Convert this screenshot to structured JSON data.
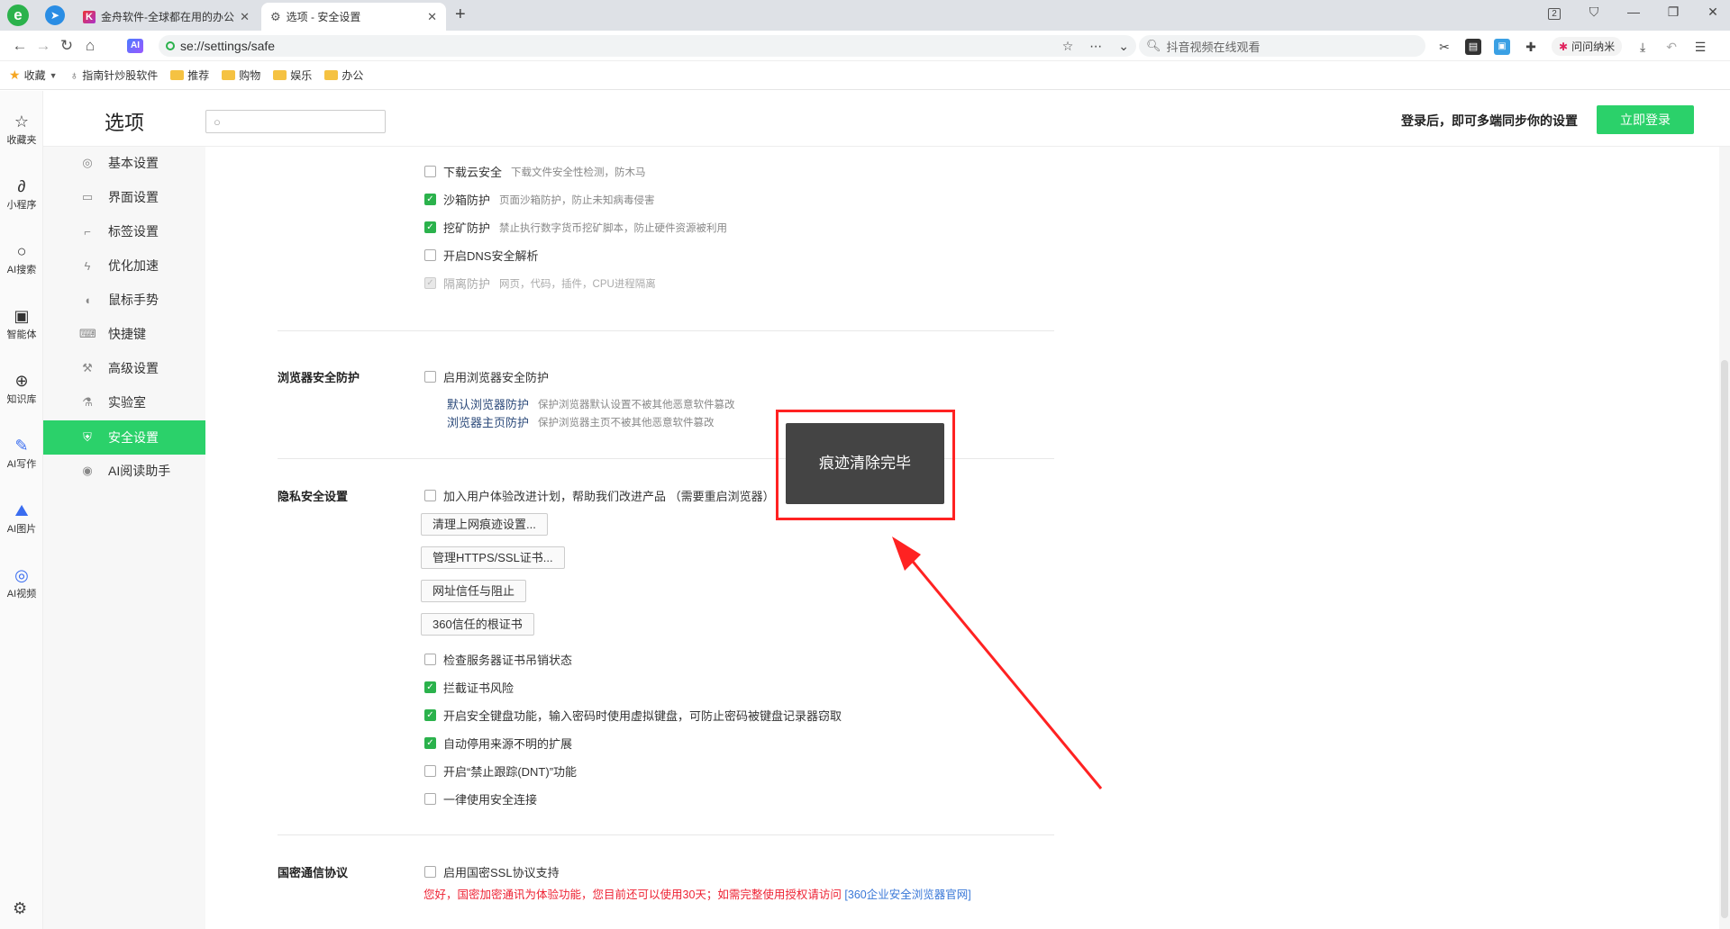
{
  "tabbar": {
    "logo": "e",
    "tabs": [
      {
        "title": "金舟软件-全球都在用的办公",
        "close": "✕"
      },
      {
        "title": "选项 - 安全设置",
        "close": "✕"
      }
    ],
    "new_tab": "+",
    "tab_count": "2"
  },
  "navbar": {
    "ai_badge": "AI",
    "url": "se://settings/safe",
    "search_placeholder": "抖音视频在线观看",
    "wenwen_label": "问问纳米"
  },
  "bookmarks": {
    "items": [
      {
        "label": "收藏",
        "type": "star"
      },
      {
        "label": "指南针炒股软件",
        "type": "link"
      },
      {
        "label": "推荐",
        "type": "folder"
      },
      {
        "label": "购物",
        "type": "folder"
      },
      {
        "label": "娱乐",
        "type": "folder"
      },
      {
        "label": "办公",
        "type": "folder"
      }
    ]
  },
  "leftbar": {
    "items": [
      {
        "label": "收藏夹",
        "icon": "star-icon"
      },
      {
        "label": "小程序",
        "icon": "link-icon"
      },
      {
        "label": "AI搜索",
        "icon": "search-icon"
      },
      {
        "label": "智能体",
        "icon": "robot-icon"
      },
      {
        "label": "知识库",
        "icon": "knowledge-icon"
      },
      {
        "label": "AI写作",
        "icon": "pen-icon"
      },
      {
        "label": "AI图片",
        "icon": "mountain-icon"
      },
      {
        "label": "AI视频",
        "icon": "film-icon"
      }
    ]
  },
  "header": {
    "title": "选项",
    "login_hint": "登录后，即可多端同步你的设置",
    "login_button": "立即登录"
  },
  "nav": {
    "active": "安全设置",
    "items": [
      {
        "label": "基本设置",
        "icon": "gear-icon"
      },
      {
        "label": "界面设置",
        "icon": "window-icon"
      },
      {
        "label": "标签设置",
        "icon": "tab-icon"
      },
      {
        "label": "优化加速",
        "icon": "bolt-icon"
      },
      {
        "label": "鼠标手势",
        "icon": "mouse-icon"
      },
      {
        "label": "快捷键",
        "icon": "keyboard-icon"
      },
      {
        "label": "高级设置",
        "icon": "wrench-icon"
      },
      {
        "label": "实验室",
        "icon": "flask-icon"
      },
      {
        "label": "安全设置",
        "icon": "shield-icon"
      },
      {
        "label": "AI阅读助手",
        "icon": "ai-icon"
      }
    ]
  },
  "content": {
    "top_options": [
      {
        "label": "下载云安全",
        "desc": "下载文件安全性检测，防木马",
        "checked": false,
        "disabled": false
      },
      {
        "label": "沙箱防护",
        "desc": "页面沙箱防护，防止未知病毒侵害",
        "checked": true,
        "disabled": false
      },
      {
        "label": "挖矿防护",
        "desc": "禁止执行数字货币挖矿脚本，防止硬件资源被利用",
        "checked": true,
        "disabled": false
      },
      {
        "label": "开启DNS安全解析",
        "desc": "",
        "checked": false,
        "disabled": false
      },
      {
        "label": "隔离防护",
        "desc": "网页，代码，插件，CPU进程隔离",
        "checked": true,
        "disabled": true
      }
    ],
    "browser_protect": {
      "title": "浏览器安全防护",
      "enable_label": "启用浏览器安全防护",
      "subs": [
        {
          "label": "默认浏览器防护",
          "desc": "保护浏览器默认设置不被其他恶意软件篡改"
        },
        {
          "label": "浏览器主页防护",
          "desc": "保护浏览器主页不被其他恶意软件篡改"
        }
      ]
    },
    "privacy": {
      "title": "隐私安全设置",
      "join_label": "加入用户体验改进计划，帮助我们改进产品 （需要重启浏览器）",
      "buttons": [
        "清理上网痕迹设置...",
        "管理HTTPS/SSL证书...",
        "网址信任与阻止",
        "360信任的根证书"
      ],
      "options": [
        {
          "label": "检查服务器证书吊销状态",
          "checked": false
        },
        {
          "label": "拦截证书风险",
          "checked": true
        },
        {
          "label": "开启安全键盘功能，输入密码时使用虚拟键盘，可防止密码被键盘记录器窃取",
          "checked": true
        },
        {
          "label": "自动停用来源不明的扩展",
          "checked": true
        },
        {
          "label": "开启“禁止跟踪(DNT)”功能",
          "checked": false
        },
        {
          "label": "一律使用安全连接",
          "checked": false
        }
      ]
    },
    "guomi": {
      "title": "国密通信协议",
      "enable_label": "启用国密SSL协议支持",
      "warning": "您好，国密加密通讯为体验功能，您目前还可以使用30天；如需完整使用授权请访问 ",
      "warning_link": "[360企业安全浏览器官网]"
    }
  },
  "toast": {
    "message": "痕迹清除完毕"
  },
  "colors": {
    "accent": "#2bd16a",
    "check": "#2bb24c",
    "annotation": "#ff2222",
    "warning": "#e22233"
  }
}
